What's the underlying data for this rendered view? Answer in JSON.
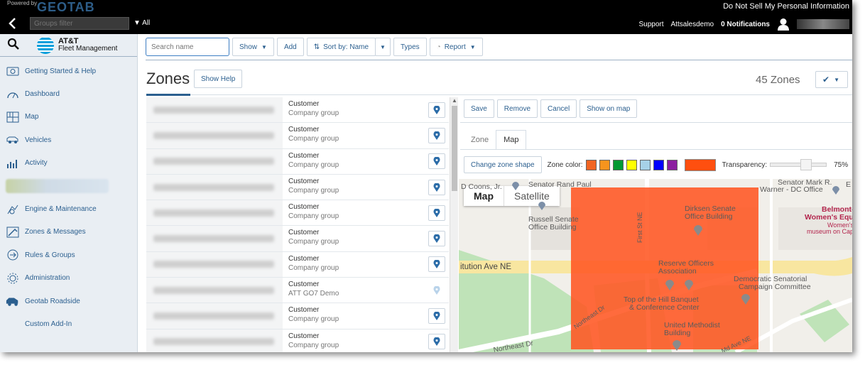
{
  "header": {
    "powered_by": "Powered by",
    "brand": "GEOTAB",
    "privacy_link": "Do Not Sell My Personal Information",
    "groups_filter_placeholder": "Groups filter",
    "groups_scope": "All",
    "support": "Support",
    "username": "Attsalesdemo",
    "notifications": "0 Notifications"
  },
  "sidebar": {
    "logo_line1": "AT&T",
    "logo_line2": "Fleet Management",
    "items": [
      {
        "label": "Getting Started & Help",
        "icon": "help-icon"
      },
      {
        "label": "Dashboard",
        "icon": "dashboard-icon"
      },
      {
        "label": "Map",
        "icon": "map-icon"
      },
      {
        "label": "Vehicles",
        "icon": "vehicle-icon"
      },
      {
        "label": "Activity",
        "icon": "activity-icon"
      },
      {
        "label": "",
        "icon": "blurred-icon"
      },
      {
        "label": "Engine & Maintenance",
        "icon": "engine-icon"
      },
      {
        "label": "Zones & Messages",
        "icon": "zones-icon"
      },
      {
        "label": "Rules & Groups",
        "icon": "rules-icon"
      },
      {
        "label": "Administration",
        "icon": "administration-icon"
      },
      {
        "label": "Geotab Roadside",
        "icon": "roadside-icon"
      },
      {
        "label": "Custom Add-In",
        "icon": ""
      }
    ]
  },
  "toolbar": {
    "search_placeholder": "Search name",
    "show": "Show",
    "add": "Add",
    "sort": "Sort by: Name",
    "types": "Types",
    "report": "Report"
  },
  "page": {
    "title": "Zones",
    "show_help": "Show Help",
    "zone_count": "45 Zones"
  },
  "zones": [
    {
      "name": "Customer",
      "group": "Company group"
    },
    {
      "name": "Customer",
      "group": "Company group"
    },
    {
      "name": "Customer",
      "group": "Company group"
    },
    {
      "name": "Customer",
      "group": "Company group"
    },
    {
      "name": "Customer",
      "group": "Company group"
    },
    {
      "name": "Customer",
      "group": "Company group"
    },
    {
      "name": "Customer",
      "group": "Company group"
    },
    {
      "name": "Customer",
      "group": "ATT GO7 Demo"
    },
    {
      "name": "Customer",
      "group": "Company group"
    },
    {
      "name": "Customer",
      "group": "Company group"
    }
  ],
  "detail": {
    "save": "Save",
    "remove": "Remove",
    "cancel": "Cancel",
    "show_on_map": "Show on map",
    "tab_zone": "Zone",
    "tab_map": "Map",
    "change_shape": "Change zone shape",
    "zone_color_label": "Zone color:",
    "zone_colors": [
      "#f26522",
      "#f7941d",
      "#009933",
      "#ffff00",
      "#a6d1e8",
      "#0000ff",
      "#8b1ea0"
    ],
    "selected_color": "#ff4f0f",
    "transparency_label": "Transparency:",
    "transparency": "75%",
    "transparency_level": 0.75
  },
  "map": {
    "type_map": "Map",
    "type_satellite": "Satellite",
    "labels": {
      "senator_rand_paul": "Senator Rand Paul",
      "senator_mark": "Senator Mark R.",
      "warner": "Warner - DC Office",
      "dcoop": "D Coons, Jr.",
      "russell1": "Russell Senate",
      "russell2": "Office Building",
      "dirksen1": "Dirksen Senate",
      "dirksen2": "Office Building",
      "belmont1": "Belmont-P",
      "belmont2": "Women's Equality",
      "womens1": "Women's h",
      "womens2": "museum on Capitol",
      "first_st": "First St NE",
      "constitution": "itution Ave NE",
      "reserve1": "Reserve Officers",
      "reserve2": "Association",
      "democratic1": "Democratic Senatorial",
      "democratic2": "Campaign Committee",
      "hill1": "Top of the Hill Banquet",
      "hill2": "& Conference Center",
      "northeast_dr1": "Northeast Dr",
      "northeast_dr2": "Northeast Dr",
      "methodist1": "United Methodist",
      "methodist2": "Building",
      "md_ave": "Md Ave NE",
      "e": "E"
    }
  }
}
